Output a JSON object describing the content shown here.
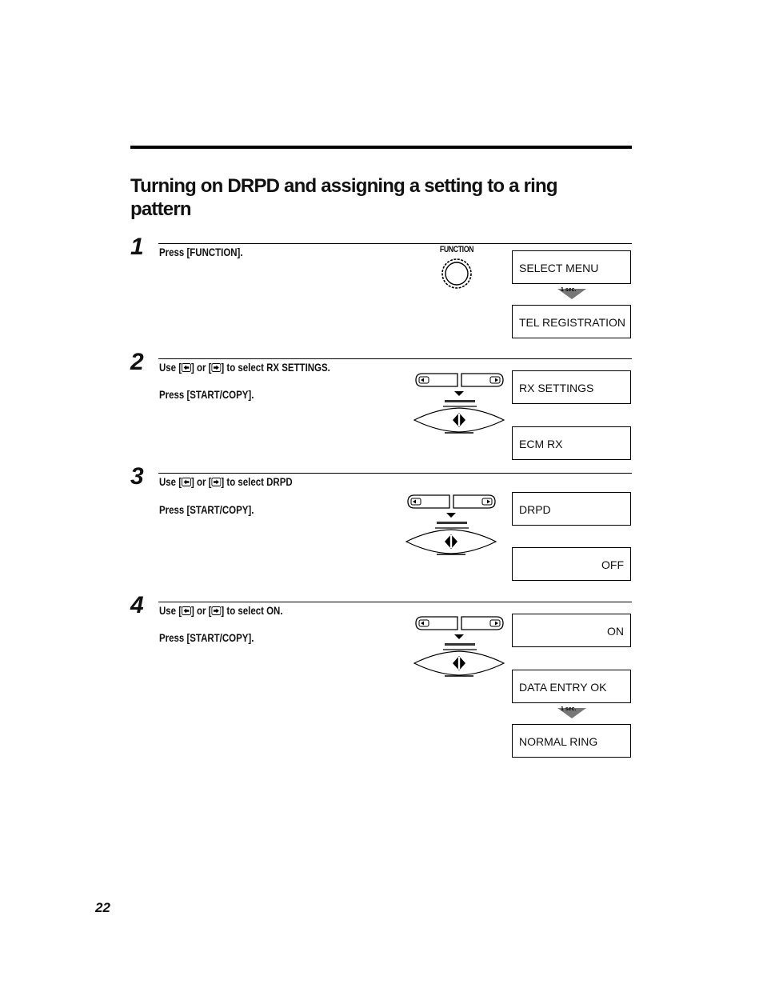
{
  "page": {
    "title": "Turning on DRPD and assigning a setting to a ring pattern",
    "page_number": "22"
  },
  "keys": {
    "function_label": "FUNCTION",
    "start_copy_label": "START/COPY",
    "left_arrow_key": "left-arrow-key-icon",
    "right_arrow_key": "right-arrow-key-icon",
    "wait_label": "1 sec."
  },
  "steps": [
    {
      "number": "1",
      "lines": [
        "Press [FUNCTION]."
      ],
      "displays": [
        "SELECT MENU",
        "TEL REGISTRATION"
      ]
    },
    {
      "number": "2",
      "use_prefix": "Use [",
      "use_mid": "] or [",
      "use_suffix": "] to select RX SETTINGS.",
      "press": "Press [START/COPY].",
      "displays": [
        "RX SETTINGS",
        "ECM RX"
      ]
    },
    {
      "number": "3",
      "use_prefix": "Use [",
      "use_mid": "] or [",
      "use_suffix": "] to select DRPD",
      "press": "Press [START/COPY].",
      "displays": [
        "DRPD",
        "OFF"
      ]
    },
    {
      "number": "4",
      "use_prefix": "Use [",
      "use_mid": "] or [",
      "use_suffix": "] to select ON.",
      "press": "Press [START/COPY].",
      "displays": [
        "ON",
        "DATA ENTRY OK",
        "NORMAL RING"
      ]
    }
  ]
}
